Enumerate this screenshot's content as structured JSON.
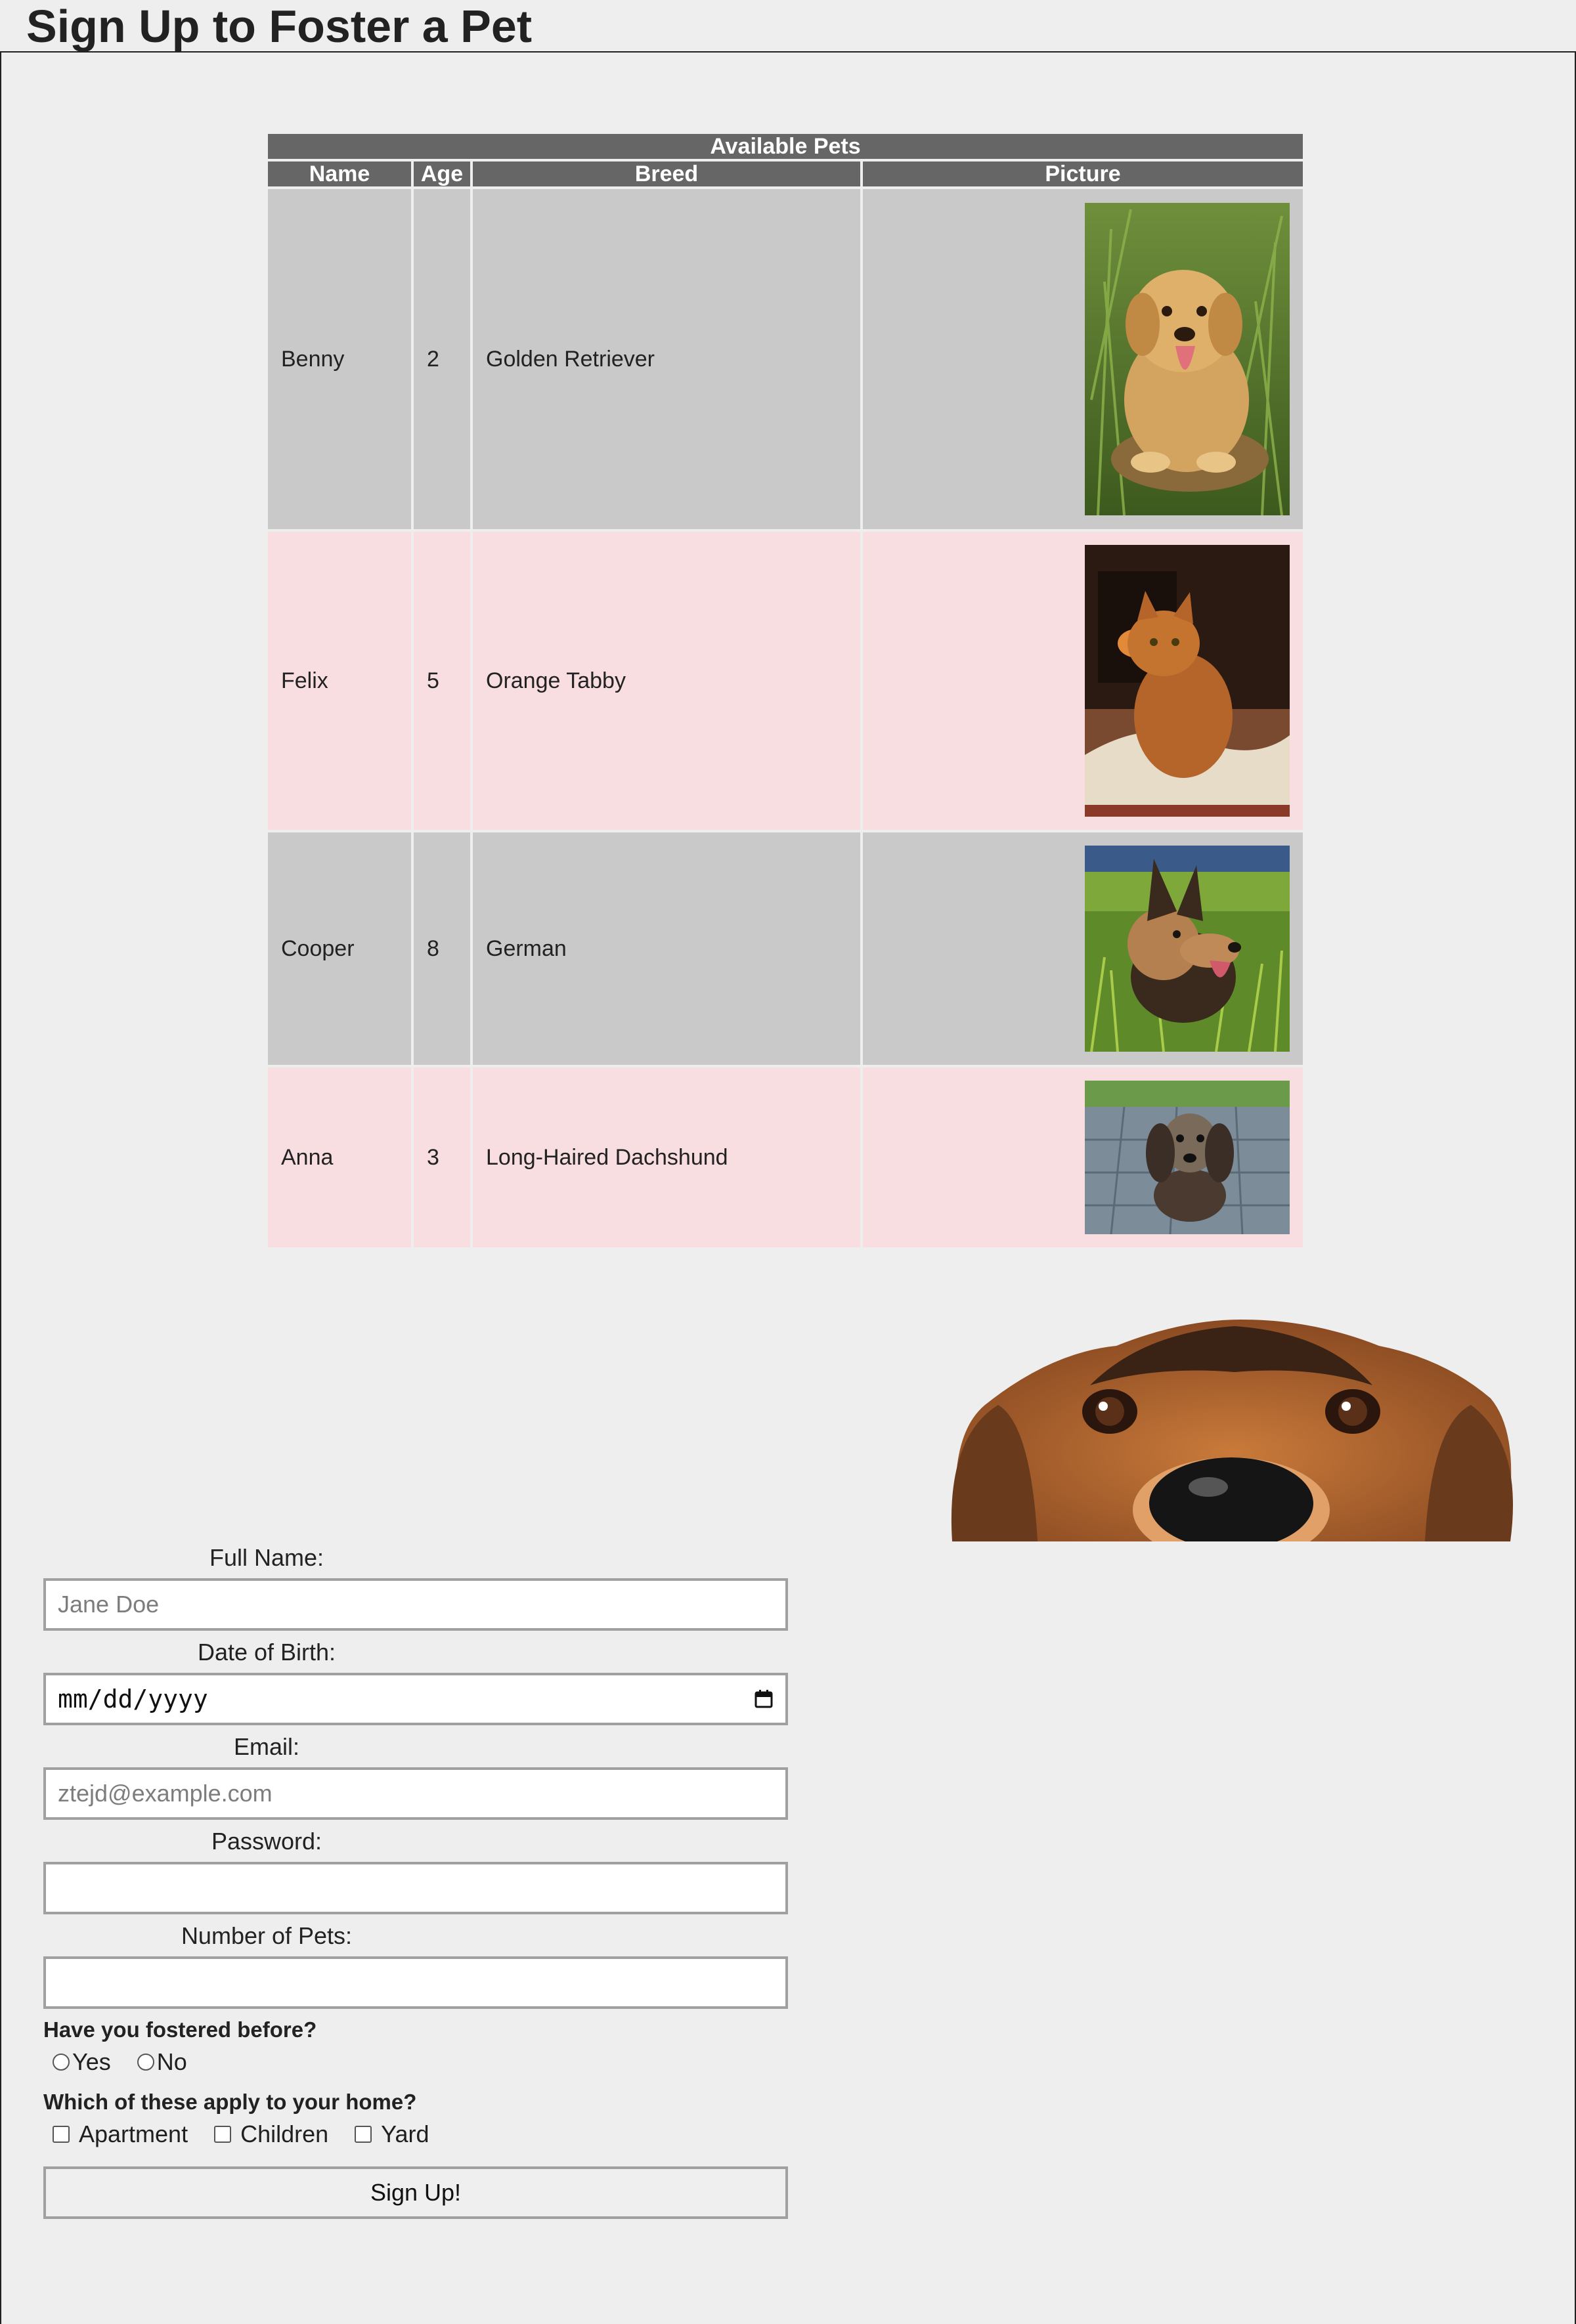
{
  "page": {
    "title": "Sign Up to Foster a Pet"
  },
  "table": {
    "caption": "Available Pets",
    "headers": [
      "Name",
      "Age",
      "Breed",
      "Picture"
    ],
    "rows": [
      {
        "name": "Benny",
        "age": "2",
        "breed": "Golden Retriever",
        "photo": "golden-retriever-photo"
      },
      {
        "name": "Felix",
        "age": "5",
        "breed": "Orange Tabby",
        "photo": "orange-tabby-cat-photo"
      },
      {
        "name": "Cooper",
        "age": "8",
        "breed": "German",
        "photo": "german-shepherd-photo"
      },
      {
        "name": "Anna",
        "age": "3",
        "breed": "Long-Haired Dachshund",
        "photo": "dachshund-photo"
      }
    ],
    "colors": {
      "header": "#666666",
      "row_odd": "#c9c9c9",
      "row_even": "#f8dde1"
    }
  },
  "decor": {
    "peek_image": "peeking-dog-photo"
  },
  "form": {
    "full_name": {
      "label": "Full Name:",
      "placeholder": "Jane Doe",
      "value": ""
    },
    "dob": {
      "label": "Date of Birth:",
      "placeholder": "mm/dd/yyyy",
      "icon": "calendar-icon"
    },
    "email": {
      "label": "Email:",
      "placeholder": "ztejd@example.com",
      "value": ""
    },
    "password": {
      "label": "Password:",
      "value": ""
    },
    "num_pets": {
      "label": "Number of Pets:",
      "value": ""
    },
    "fostered": {
      "question": "Have you fostered before?",
      "options": [
        "Yes",
        "No"
      ]
    },
    "home": {
      "question": "Which of these apply to your home?",
      "options": [
        "Apartment",
        "Children",
        "Yard"
      ]
    },
    "submit_label": "Sign Up!"
  }
}
